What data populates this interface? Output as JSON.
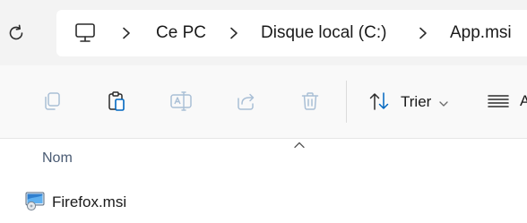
{
  "addressbar": {
    "refresh_icon": "refresh-icon",
    "root_icon": "computer-icon",
    "breadcrumbs": [
      "Ce PC",
      "Disque local (C:)",
      "App.msi"
    ]
  },
  "toolbar": {
    "buttons": [
      {
        "icon": "copy-icon",
        "enabled": false
      },
      {
        "icon": "paste-icon",
        "enabled": true
      },
      {
        "icon": "rename-icon",
        "enabled": false
      },
      {
        "icon": "share-icon",
        "enabled": false
      },
      {
        "icon": "delete-icon",
        "enabled": false
      }
    ],
    "sort_label": "Trier",
    "view_label": "A"
  },
  "columns": {
    "name_header": "Nom"
  },
  "files": [
    {
      "name": "Firefox.msi",
      "icon": "msi-installer-icon"
    }
  ],
  "colors": {
    "accent": "#0067c0",
    "disabled_icon": "#a9bfd6",
    "header_text": "#4a5b73"
  }
}
